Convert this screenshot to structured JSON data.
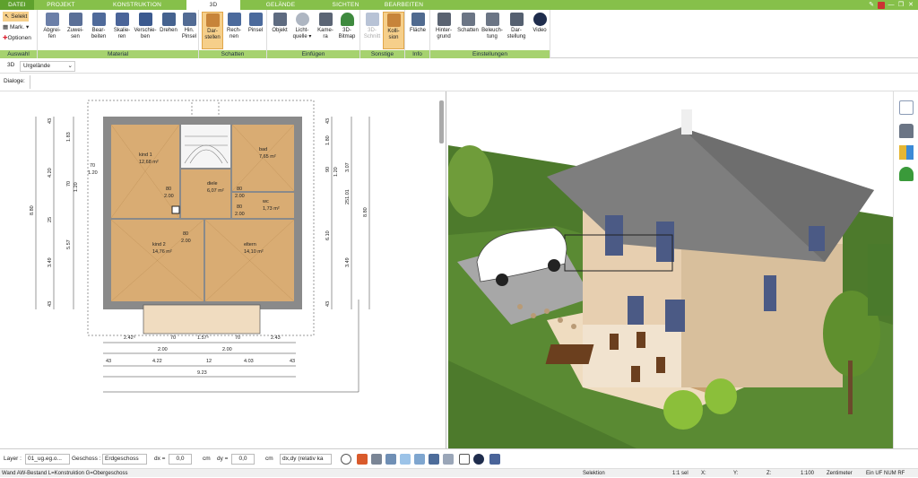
{
  "tabs": [
    "DATEI",
    "PROJEKT",
    "KONSTRUKTION",
    "3D",
    "GELÄNDE",
    "SICHTEN",
    "BEARBEITEN"
  ],
  "window_controls": [
    "pin-icon",
    "help-icon",
    "minimize-icon",
    "restore-icon",
    "close-icon"
  ],
  "selection": {
    "selekt": "Selekt",
    "mark": "Mark.",
    "optionen": "Optionen"
  },
  "groups": {
    "auswahl": "Auswahl",
    "material": "Material",
    "schatten": "Schatten",
    "einfuegen": "Einfügen",
    "sonstige": "Sonstige",
    "info": "Info",
    "einstellungen": "Einstellungen"
  },
  "buttons": {
    "abgreifen": "Abgrei-\nfen",
    "zuweisen": "Zuwei-\nsen",
    "bearbeiten": "Bear-\nbeiten",
    "skalieren": "Skalie-\nren",
    "verschieben": "Verschie-\nben",
    "drehen": "Drehen",
    "hin_pinsel": "Hin.\nPinsel",
    "darstellen": "Dar-\nstellen",
    "rechnen": "Rech-\nnen",
    "pinsel": "Pinsel",
    "objekt": "Objekt",
    "lichtquelle": "Licht-\nquelle ▾",
    "kamera": "Kame-\nra",
    "bitmap3d": "3D-\nBitmap",
    "schnitt3d": "3D-\nSchnitt",
    "kollision": "Kolli-\nsion",
    "flaeche": "Fläche",
    "hintergrund": "Hinter-\ngrund",
    "schatten": "Schatten",
    "beleuchtung": "Beleuch-\ntung",
    "darstellung": "Dar-\nstellung",
    "video": "Video"
  },
  "viewbar": {
    "mode": "3D",
    "terrain": "Urgelände"
  },
  "dialog_label": "Dialoge:",
  "plan": {
    "rooms": [
      {
        "name": "kind 1",
        "area": "12,68 m²"
      },
      {
        "name": "bad",
        "area": "7,65 m²"
      },
      {
        "name": "diele",
        "area": "6,07 m²"
      },
      {
        "name": "wc",
        "area": "1,73 m²"
      },
      {
        "name": "kind 2",
        "area": "14,76 m²"
      },
      {
        "name": "eltern",
        "area": "14,10 m²"
      }
    ],
    "dims_left": [
      "43",
      "1.83",
      "4.20",
      "70",
      "1.20",
      "25",
      "8.80",
      "5.57",
      "3.49",
      "43"
    ],
    "dims_right": [
      "43",
      "1.80",
      "3.07",
      "90",
      "1.20",
      "251.01",
      "6.10",
      "8.80",
      "3.49",
      "43"
    ],
    "dims_bottom_row1": [
      "2.42⁵",
      "70",
      "1.57⁵",
      "70",
      "2.43"
    ],
    "dims_bottom_row2": [
      "2.00",
      "2.00"
    ],
    "dims_bottom_row3": [
      "43",
      "4.22",
      "12",
      "4.03",
      "43"
    ],
    "dims_total": "9.23",
    "door_dims": [
      "80",
      "2.00",
      "80",
      "2.00",
      "80",
      "2.00",
      "80",
      "2.00",
      "70",
      "1.20"
    ]
  },
  "bottom": {
    "layer_label": "Layer :",
    "layer_value": "01_ug.eg.o...",
    "floor_label": "Geschoss :",
    "floor_value": "Erdgeschoss",
    "dx_label": "dx =",
    "dx_value": "0,0",
    "dx_unit": "cm",
    "dy_label": "dy =",
    "dy_value": "0,0",
    "dy_unit": "cm",
    "mode_value": "dx,dy (relativ ka"
  },
  "status": {
    "left": "Wand AW-Bestand L=Konstruktion G=Obergeschoss",
    "selektion": "Selektion",
    "sel_count": "1:1 sel",
    "x": "X:",
    "y": "Y:",
    "z": "Z:",
    "scale": "1:100",
    "unit": "Zentimeter",
    "flags": "Ein  UF  NUM  RF"
  },
  "colors": {
    "ribbon_tab": "#86c04a",
    "group_label": "#a6d26f",
    "room_floor": "#d9ac73",
    "wall": "#8a8a8a",
    "lawn": "#4d7a2c",
    "sky": "#ffffff",
    "selected": "#f6cf8a"
  }
}
